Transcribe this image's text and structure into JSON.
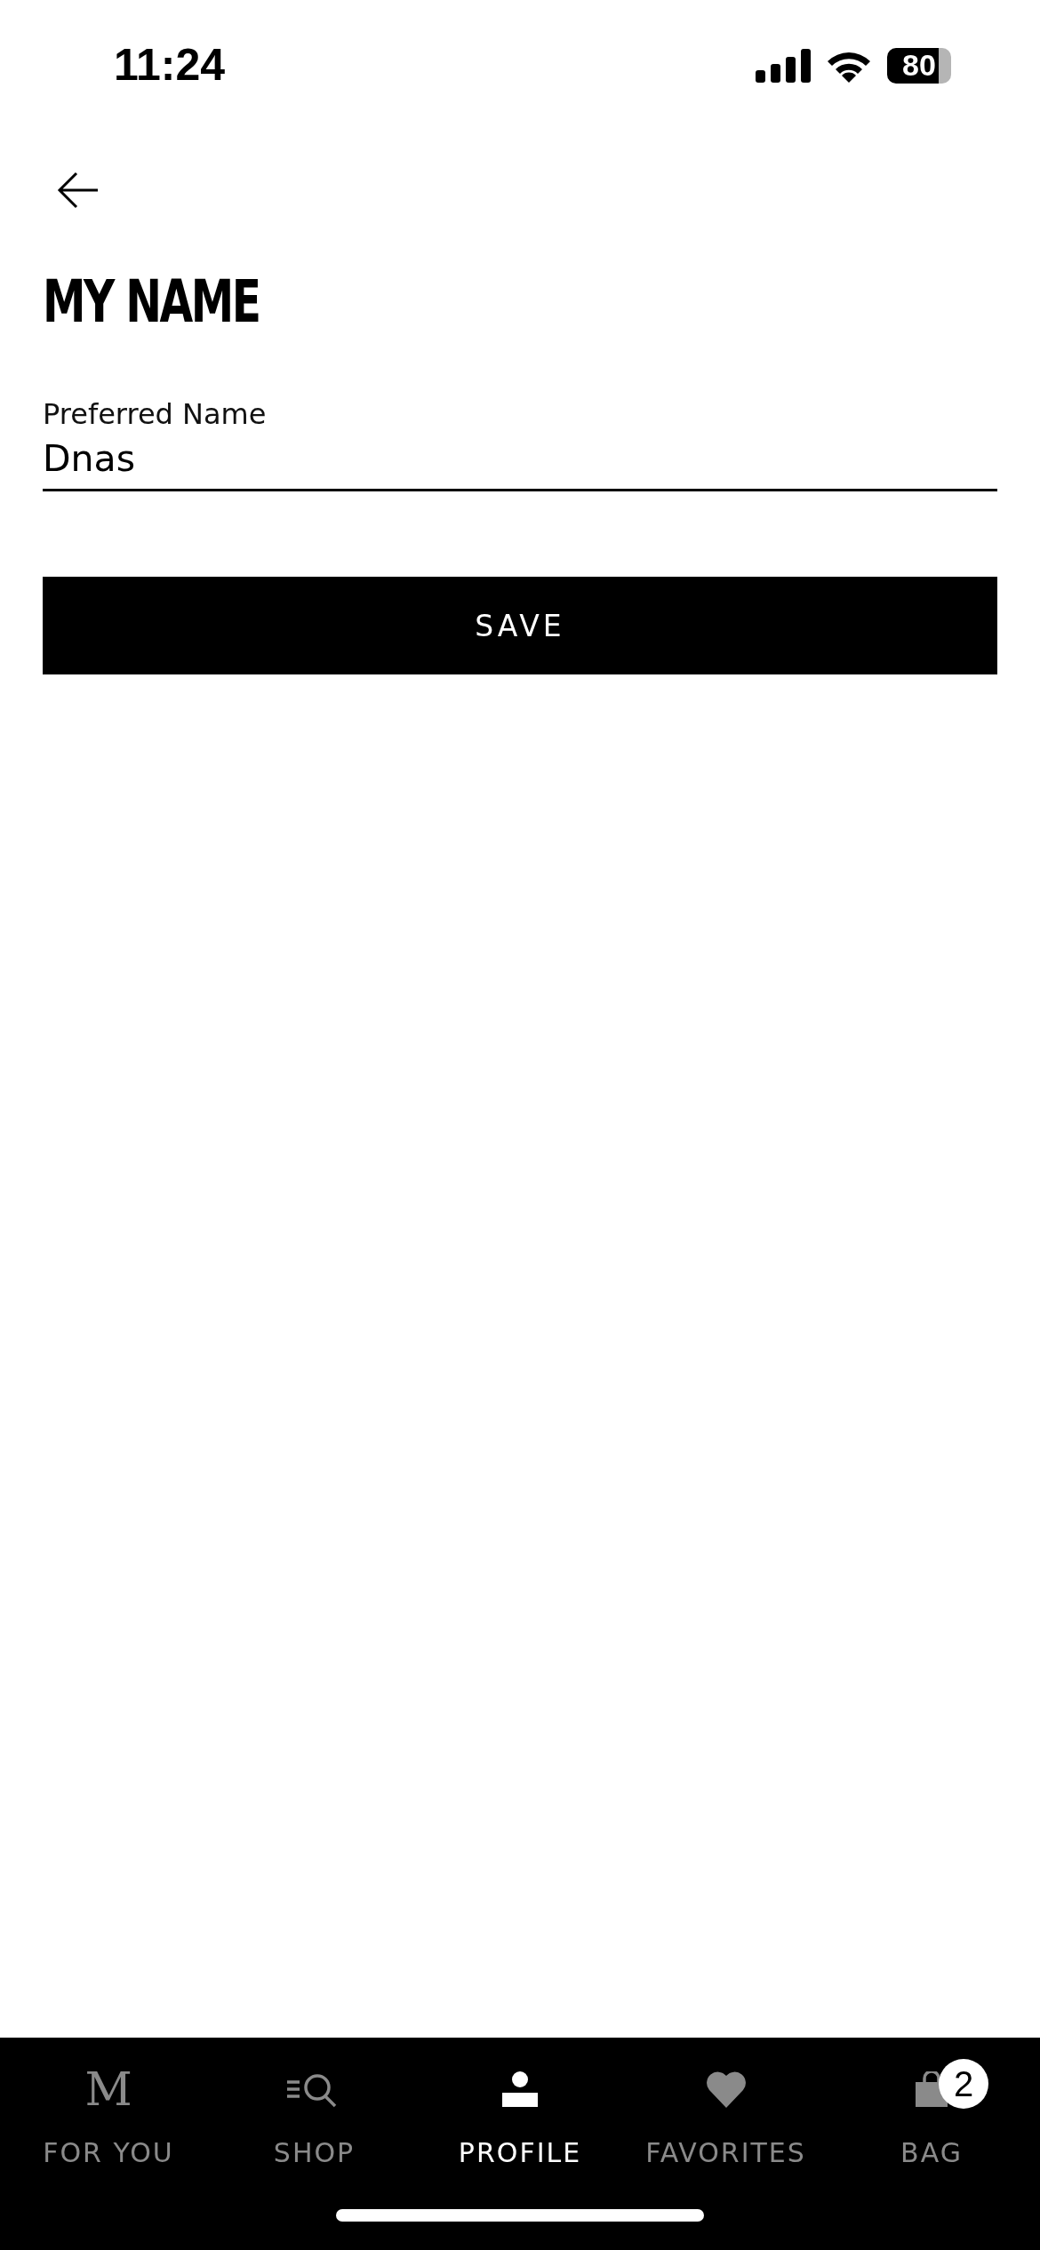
{
  "status_bar": {
    "time": "11:24",
    "battery": "80"
  },
  "title": "MY NAME",
  "field": {
    "label": "Preferred Name",
    "value": "Dnas"
  },
  "save_button": "SAVE",
  "tabs": [
    {
      "kind": "logo",
      "glyph": "M",
      "label": "FOR YOU",
      "selected": false
    },
    {
      "kind": "shop",
      "label": "SHOP",
      "selected": false
    },
    {
      "kind": "profile",
      "label": "PROFILE",
      "selected": true
    },
    {
      "kind": "favorites",
      "label": "FAVORITES",
      "selected": false
    },
    {
      "kind": "bag",
      "label": "BAG",
      "badge": "2",
      "selected": false
    }
  ]
}
